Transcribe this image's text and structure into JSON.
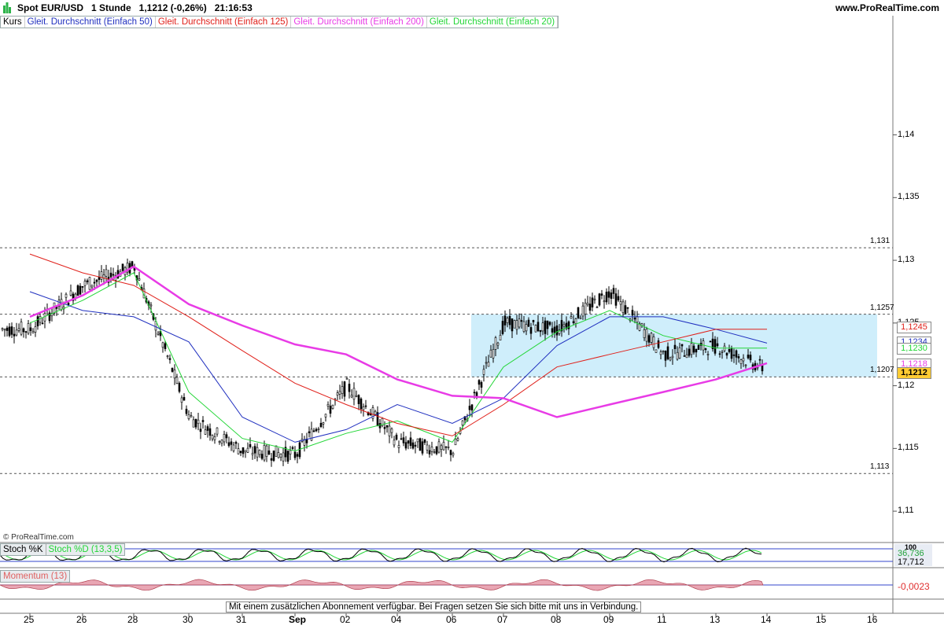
{
  "header": {
    "title": "Spot EUR/USD   1 Stunde   1,1212 (-0,26%)   21:16:53",
    "site": "www.ProRealTime.com"
  },
  "legend": {
    "kurs": "Kurs",
    "ma50": "Gleit. Durchschnitt (Einfach 50)",
    "ma125": "Gleit. Durchschnitt (Einfach 125)",
    "ma200": "Gleit. Durchschnitt (Einfach 200)",
    "ma20": "Gleit. Durchschnitt (Einfach 20)"
  },
  "copyright": "© ProRealTime.com",
  "notice": "Mit einem zusätzlichen Abonnement verfügbar. Bei Fragen setzen Sie sich bitte mit uns in Verbindung.",
  "price_axis": [
    "1,14",
    "1,135",
    "1,13",
    "1,125",
    "1,12",
    "1,115",
    "1,11"
  ],
  "hlines": [
    "1,131",
    "1,1257",
    "1,1207",
    "1,113"
  ],
  "price_tags": [
    "1,1245",
    "1,1234",
    "1,1230",
    "1,1218",
    "1,1212"
  ],
  "stoch": {
    "k_label": "Stoch %K",
    "d_label": "Stoch %D (13,3,5)",
    "val1": "36,736",
    "val2": "17,712",
    "top": "100"
  },
  "momentum": {
    "label": "Momentum (13)",
    "value": "-0,0023"
  },
  "dates": [
    "25",
    "26",
    "28",
    "30",
    "31",
    "Sep",
    "02",
    "04",
    "06",
    "07",
    "08",
    "09",
    "11",
    "13",
    "14",
    "15",
    "16"
  ],
  "colors": {
    "ma50": "#1f2fbf",
    "ma125": "#e0201a",
    "ma200": "#e83be6",
    "ma20": "#22d636",
    "zone": "#cfeefb",
    "tag_last": "#ffcc33"
  },
  "chart_data": {
    "type": "line",
    "title": "Spot EUR/USD 1 Stunde",
    "ylim": [
      1.1075,
      1.1495
    ],
    "y_ticks": [
      1.14,
      1.135,
      1.13,
      1.125,
      1.12,
      1.115,
      1.11
    ],
    "x": [
      "25",
      "26",
      "28",
      "30",
      "31",
      "Sep",
      "02",
      "04",
      "06",
      "07",
      "08",
      "09",
      "11",
      "13",
      "14"
    ],
    "series": [
      {
        "name": "Kurs",
        "values": [
          1.1245,
          1.128,
          1.1295,
          1.1175,
          1.1148,
          1.1145,
          1.12,
          1.1155,
          1.1148,
          1.125,
          1.1245,
          1.1275,
          1.1225,
          1.1232,
          1.1212
        ]
      },
      {
        "name": "Gleit. Durchschnitt (Einfach 20)",
        "values": [
          1.125,
          1.1268,
          1.129,
          1.1195,
          1.1158,
          1.1148,
          1.1162,
          1.1172,
          1.1155,
          1.1215,
          1.1243,
          1.126,
          1.124,
          1.123,
          1.123
        ]
      },
      {
        "name": "Gleit. Durchschnitt (Einfach 50)",
        "values": [
          1.1275,
          1.126,
          1.1255,
          1.1235,
          1.1175,
          1.1155,
          1.1165,
          1.1185,
          1.117,
          1.119,
          1.1232,
          1.1255,
          1.1255,
          1.1245,
          1.1234
        ]
      },
      {
        "name": "Gleit. Durchschnitt (Einfach 125)",
        "values": [
          1.1305,
          1.129,
          1.128,
          1.1255,
          1.1228,
          1.1202,
          1.1185,
          1.117,
          1.116,
          1.1185,
          1.1215,
          1.1225,
          1.1235,
          1.1245,
          1.1245
        ]
      },
      {
        "name": "Gleit. Durchschnitt (Einfach 200)",
        "values": [
          1.1255,
          1.1272,
          1.1295,
          1.1265,
          1.1248,
          1.1233,
          1.1225,
          1.1205,
          1.1192,
          1.119,
          1.1175,
          1.1185,
          1.1195,
          1.1205,
          1.1218
        ]
      }
    ],
    "levels": [
      1.131,
      1.1257,
      1.1207,
      1.113
    ],
    "zone": [
      1.1207,
      1.1257
    ],
    "legend": "top-left",
    "grid": false
  }
}
